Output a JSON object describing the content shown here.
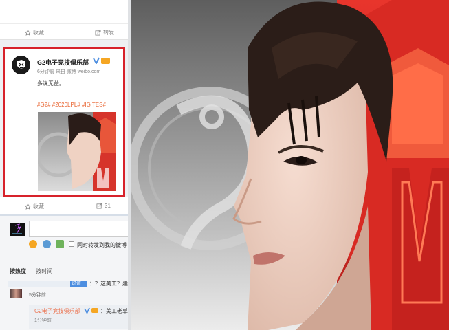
{
  "feed": {
    "top_actions": {
      "favorite": "收藏",
      "repost": "转发"
    },
    "post": {
      "username": "G2电子竞技俱乐部",
      "meta": "6分钟前 来自 微博 weibo.com",
      "text": "多说无益。",
      "hashtags": "#G2# #2020LPL# #IG TES#"
    },
    "bottom_actions": {
      "favorite": "收藏",
      "repost_count": "31"
    },
    "composer": {
      "checkbox_label": "同时转发到我的微博"
    },
    "sort": {
      "hot": "按热度",
      "time": "按时间"
    },
    "comments": [
      {
        "highlight": "说道",
        "text": "：？这美工？建议加",
        "time": "5分钟前"
      }
    ],
    "reply": {
      "username": "G2电子竞技俱乐部",
      "text": "：美工老草加",
      "time": "1分钟前"
    }
  },
  "colors": {
    "accent_red": "#d7222b",
    "hashtag_orange": "#e8612c",
    "link_orange": "#eb7350",
    "badge_gold": "#f5a623",
    "verified_blue": "#4d8ee0"
  }
}
